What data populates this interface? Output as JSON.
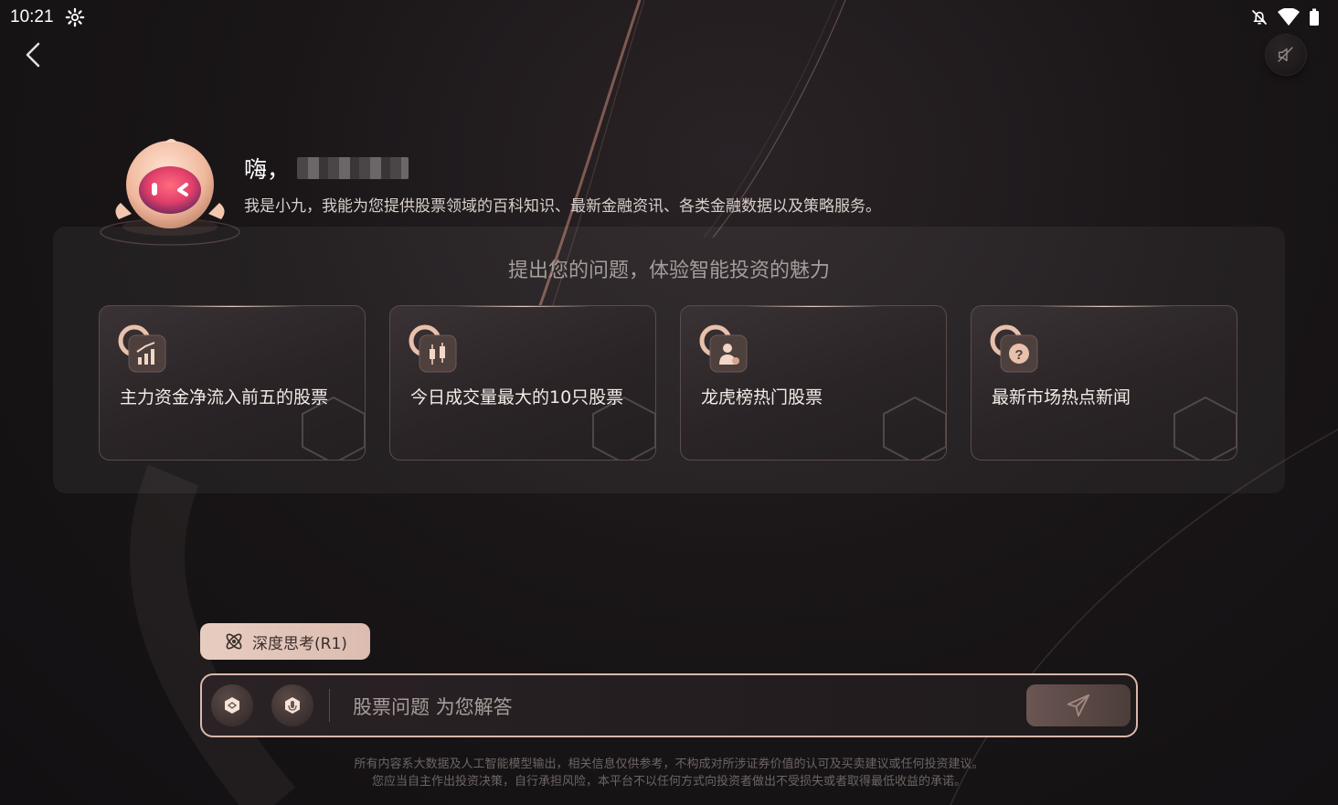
{
  "status_bar": {
    "time": "10:21",
    "icons": [
      "settings-gear-icon",
      "notifications-off-icon",
      "wifi-icon",
      "battery-icon"
    ]
  },
  "header": {
    "back_icon": "chevron-left-icon",
    "mute_icon": "speaker-muted-icon"
  },
  "greeting": {
    "hello": "嗨，",
    "intro": "我是小九，我能为您提供股票领域的百科知识、最新金融资讯、各类金融数据以及策略服务。"
  },
  "panel": {
    "title": "提出您的问题，体验智能投资的魅力",
    "cards": [
      {
        "text": "主力资金净流入前五的股票",
        "icon": "chart-bars-icon"
      },
      {
        "text": "今日成交量最大的10只股票",
        "icon": "candlestick-icon"
      },
      {
        "text": "龙虎榜热门股票",
        "icon": "user-heart-icon"
      },
      {
        "text": "最新市场热点新闻",
        "icon": "question-bubble-icon"
      }
    ]
  },
  "deep_think": {
    "label": "深度思考(R1)",
    "icon": "atom-icon"
  },
  "input": {
    "placeholder": "股票问题 为您解答",
    "value": "",
    "left_buttons": [
      "cube-icon",
      "microphone-icon"
    ],
    "send_icon": "send-plane-icon"
  },
  "disclaimer": {
    "line1": "所有内容系大数据及人工智能模型输出，相关信息仅供参考，不构成对所涉证券价值的认可及买卖建议或任何投资建议。",
    "line2": "您应当自主作出投资决策，自行承担风险，本平台不以任何方式向投资者做出不受损失或者取得最低收益的承诺。"
  },
  "colors": {
    "accent": "#e2c6b8",
    "border": "#d9b8ab",
    "background": "#1a1618"
  }
}
